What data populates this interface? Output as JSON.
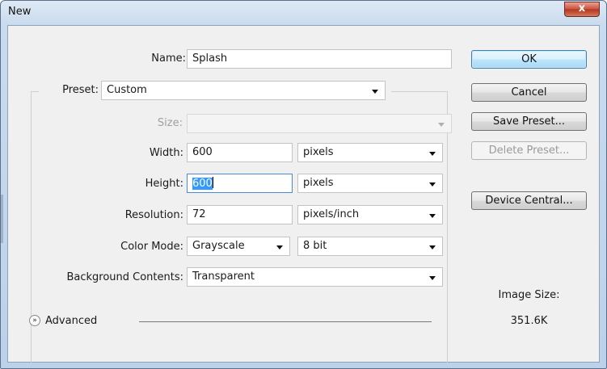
{
  "window": {
    "title": "New",
    "close_glyph": "x"
  },
  "form": {
    "name": {
      "label": "Name:",
      "value": "Splash"
    },
    "preset": {
      "label": "Preset:",
      "value": "Custom"
    },
    "size": {
      "label": "Size:",
      "value": ""
    },
    "width": {
      "label": "Width:",
      "value": "600",
      "unit": "pixels"
    },
    "height": {
      "label": "Height:",
      "value": "600",
      "unit": "pixels"
    },
    "resolution": {
      "label": "Resolution:",
      "value": "72",
      "unit": "pixels/inch"
    },
    "color_mode": {
      "label": "Color Mode:",
      "value": "Grayscale",
      "depth": "8 bit"
    },
    "background": {
      "label": "Background Contents:",
      "value": "Transparent"
    },
    "advanced": {
      "label": "Advanced",
      "icon": "double-chevron-down-icon"
    }
  },
  "buttons": {
    "ok": "OK",
    "cancel": "Cancel",
    "save_preset": "Save Preset...",
    "delete_preset": "Delete Preset...",
    "device_central": "Device Central..."
  },
  "image_size": {
    "label": "Image Size:",
    "value": "351.6K"
  }
}
